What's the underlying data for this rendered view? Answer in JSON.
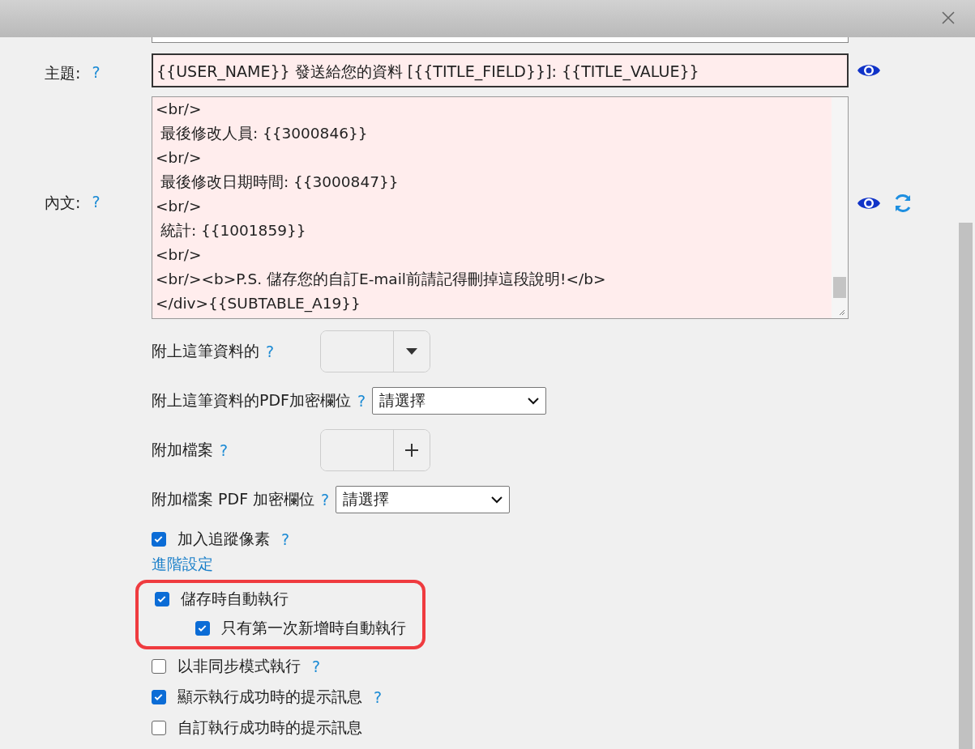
{
  "subject": {
    "label": "主題:",
    "help": "?",
    "value": "{{USER_NAME}} 發送給您的資料 [{{TITLE_FIELD}}]: {{TITLE_VALUE}}"
  },
  "body": {
    "label": "內文:",
    "help": "?",
    "lines": [
      "<br/>",
      " 最後修改人員: {{3000846}}",
      "<br/>",
      " 最後修改日期時間: {{3000847}}",
      "<br/>",
      " 統計: {{1001859}}",
      "<br/>",
      "<br/><b>P.S. 儲存您的自訂E-mail前請記得刪掉這段說明!</b>",
      "</div>{{SUBTABLE_A19}}"
    ]
  },
  "attachments": [
    {
      "kind": "menu-picker",
      "label": "附上這筆資料的",
      "help": "?"
    },
    {
      "kind": "select",
      "label": "附上這筆資料的PDF加密欄位",
      "help": "?",
      "value": "請選擇"
    },
    {
      "kind": "add-picker",
      "label": "附加檔案",
      "help": "?"
    },
    {
      "kind": "select",
      "label": "附加檔案 PDF 加密欄位",
      "help": "?",
      "value": "請選擇"
    }
  ],
  "options": [
    {
      "kind": "checkbox",
      "label": "加入追蹤像素",
      "help": "?",
      "checked": true
    },
    {
      "kind": "link",
      "label": "進階設定"
    },
    {
      "kind": "group",
      "highlighted": true,
      "items": [
        {
          "label": "儲存時自動執行",
          "checked": true,
          "children": [
            {
              "label": "只有第一次新增時自動執行",
              "checked": true
            }
          ]
        }
      ]
    },
    {
      "kind": "checkbox",
      "label": "以非同步模式執行",
      "help": "?",
      "checked": false
    },
    {
      "kind": "checkbox",
      "label": "顯示執行成功時的提示訊息",
      "help": "?",
      "checked": true
    },
    {
      "kind": "checkbox",
      "label": "自訂執行成功時的提示訊息",
      "checked": false
    }
  ]
}
